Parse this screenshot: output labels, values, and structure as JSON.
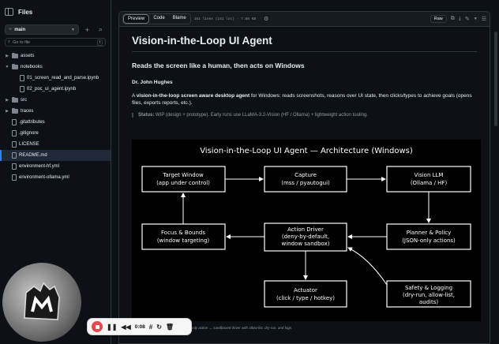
{
  "sidebar": {
    "title": "Files",
    "branch": "main",
    "goto_placeholder": "Go to file",
    "goto_key": "t",
    "tree": [
      {
        "label": "assets",
        "kind": "folder",
        "expanded": false,
        "indent": 0
      },
      {
        "label": "notebooks",
        "kind": "folder",
        "expanded": true,
        "indent": 0
      },
      {
        "label": "01_screen_read_and_parse.ipynb",
        "kind": "file",
        "indent": 1
      },
      {
        "label": "02_poc_ui_agent.ipynb",
        "kind": "file",
        "indent": 1
      },
      {
        "label": "src",
        "kind": "folder",
        "expanded": false,
        "indent": 0
      },
      {
        "label": "traces",
        "kind": "folder",
        "expanded": false,
        "indent": 0
      },
      {
        "label": ".gitattributes",
        "kind": "file",
        "indent": 0
      },
      {
        "label": ".gitignore",
        "kind": "file",
        "indent": 0
      },
      {
        "label": "LICENSE",
        "kind": "file",
        "indent": 0
      },
      {
        "label": "README.md",
        "kind": "file",
        "indent": 0,
        "active": true
      },
      {
        "label": "environment-hf.yml",
        "kind": "file",
        "indent": 0
      },
      {
        "label": "environment-ollama.yml",
        "kind": "file",
        "indent": 0
      }
    ]
  },
  "toolbar": {
    "tabs": [
      "Preview",
      "Code",
      "Blame"
    ],
    "active_tab": "Preview",
    "meta": "161 lines (141 loc) · 7.86 KB",
    "raw_label": "Raw"
  },
  "readme": {
    "title": "Vision-in-the-Loop UI Agent",
    "subtitle": "Reads the screen like a human, then acts on Windows",
    "author": "Dr. John Hughes",
    "desc_pre": "A ",
    "desc_bold": "vision-in-the-loop screen aware desktop agent",
    "desc_post": " for Windows: reads screenshots, reasons over UI state, then clicks/types to achieve goals (opens files, exports reports, etc.).",
    "status_label": "Status:",
    "status_text": " WIP (design + prototype). Early runs use LLaMA-3.2-Vision (HF / Ollama) + lightweight action tooling.",
    "caption": "Pixels in → parsed UI state → JSON-only action → sandboxed driver with allow-list, dry-run, and logs."
  },
  "diagram": {
    "title": "Vision-in-the-Loop UI Agent — Architecture (Windows)",
    "nodes": {
      "target": [
        "Target Window",
        "(app under control)"
      ],
      "capture": [
        "Capture",
        "(mss / pyautogui)"
      ],
      "vision": [
        "Vision LLM",
        "(Ollama / HF)"
      ],
      "focus": [
        "Focus & Bounds",
        "(window targeting)"
      ],
      "driver": [
        "Action Driver",
        "(deny-by-default,",
        "window sandbox)"
      ],
      "planner": [
        "Planner & Policy",
        "(JSON-only actions)"
      ],
      "actuator": [
        "Actuator",
        "(click / type / hotkey)"
      ],
      "safety": [
        "Safety & Logging",
        "(dry-run, allow-list,",
        "audits)"
      ]
    }
  },
  "recorder": {
    "time": "0:08"
  },
  "colors": {
    "bg": "#0d1117",
    "border": "#30363d",
    "accent": "#2f81f7",
    "record": "#e5484d"
  }
}
